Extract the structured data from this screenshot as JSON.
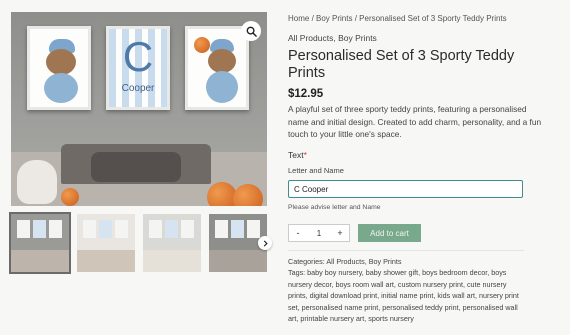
{
  "breadcrumb": {
    "home": "Home",
    "sep1": " / ",
    "category": "Boy Prints",
    "sep2": " / ",
    "current": "Personalised Set of 3 Sporty Teddy Prints"
  },
  "product": {
    "categories": "All Products, Boy Prints",
    "title": "Personalised Set of 3 Sporty Teddy Prints",
    "price": "$12.95",
    "description": "A playful set of three sporty teddy prints, featuring a personalised name and initial design. Created to add charm, personality, and a fun touch to your little one's space."
  },
  "gallery": {
    "print_initial": "C",
    "print_name": "Cooper",
    "icons": {
      "zoom": "magnifier-icon",
      "next": "chevron-right-icon"
    }
  },
  "form": {
    "text_label": "Text",
    "required_mark": "*",
    "letter_label": "Letter and Name",
    "letter_value": "C Cooper",
    "hint": "Please advise letter and Name",
    "quantity": "1",
    "minus": "-",
    "plus": "+",
    "add_to_cart": "Add to cart"
  },
  "meta": {
    "categories": "Categories: All Products, Boy Prints",
    "tags": "Tags: baby boy nursery, baby shower gift, boys bedroom decor, boys nursery decor, boys room wall art, custom nursery print, cute nursery prints, digital download print, initial name print, kids wall art, nursery print set, personalised name print, personalised teddy print, personalised wall art, printable nursery art, sports nursery"
  },
  "colors": {
    "accent": "#79a98d",
    "input_border": "#3f8d8d",
    "required": "#d43a3a"
  }
}
